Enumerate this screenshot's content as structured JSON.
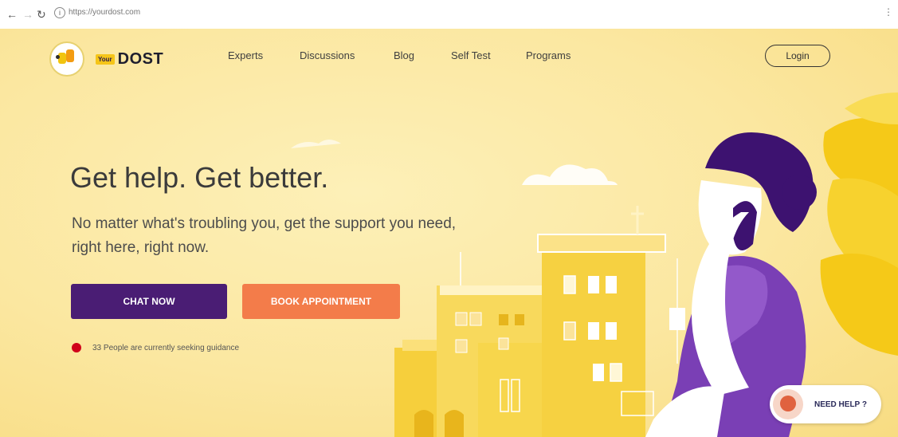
{
  "browser": {
    "url": "https://yourdost.com",
    "back_icon": "arrow-left-icon",
    "forward_icon": "arrow-right-icon",
    "reload_icon": "reload-icon",
    "info_icon": "info-icon",
    "menu_icon": "kebab-menu-icon"
  },
  "header": {
    "logo_your": "Your",
    "logo_dost": "DOST",
    "nav": [
      "Experts",
      "Discussions",
      "Blog",
      "Self Test",
      "Programs"
    ],
    "login_label": "Login"
  },
  "hero": {
    "title": "Get help. Get better.",
    "subtitle": "No matter what's troubling you, get the support you need, right here, right now.",
    "chat_label": "CHAT NOW",
    "book_label": "BOOK APPOINTMENT",
    "status_text": "33 People are currently seeking guidance"
  },
  "help_widget": {
    "label": "NEED HELP ?"
  },
  "colors": {
    "background": "#fbe9a4",
    "chat_button": "#4a1d74",
    "book_button": "#f37c4a",
    "status_dot": "#d0021b"
  }
}
